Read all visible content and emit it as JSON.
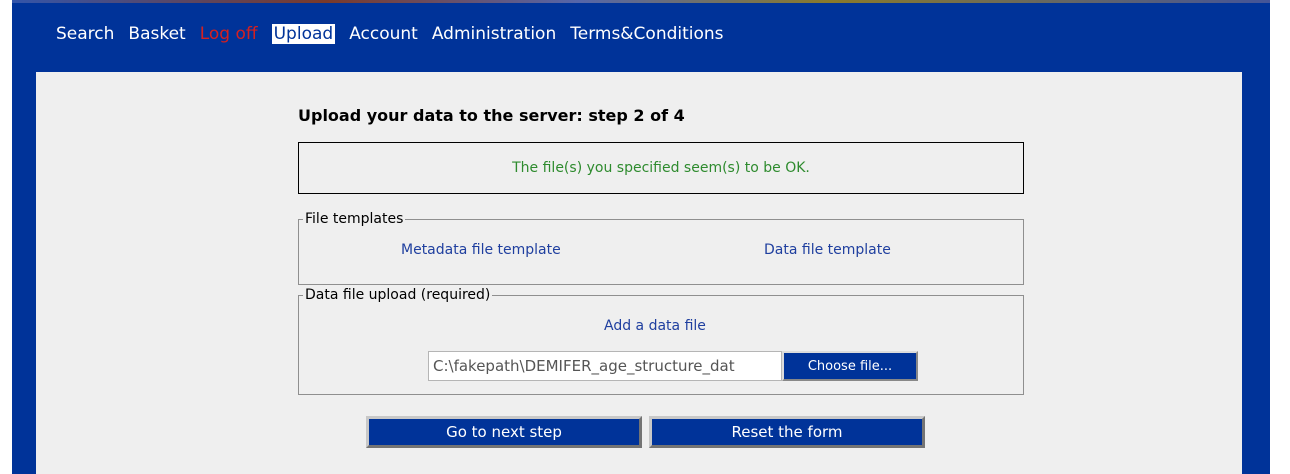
{
  "nav": {
    "items": [
      {
        "label": "Search"
      },
      {
        "label": "Basket"
      },
      {
        "label": "Log off"
      },
      {
        "label": "Upload"
      },
      {
        "label": "Account"
      },
      {
        "label": "Administration"
      },
      {
        "label": "Terms&Conditions"
      }
    ],
    "active": "Upload"
  },
  "page": {
    "title": "Upload your data to the server: step 2 of 4",
    "status_message": "The file(s) you specified seem(s) to be OK."
  },
  "templates": {
    "legend": "File templates",
    "metadata_link": "Metadata file template",
    "data_link": "Data file template"
  },
  "upload": {
    "legend": "Data file upload (required)",
    "add_link": "Add a data file",
    "file_value": "C:\\fakepath\\DEMIFER_age_structure_dat",
    "choose_label": "Choose file..."
  },
  "actions": {
    "next_label": "Go to next step",
    "reset_label": "Reset the form"
  },
  "colors": {
    "brand": "#003399",
    "success": "#2e8b2e",
    "logoff": "#d42020",
    "link": "#1f3f9f"
  }
}
